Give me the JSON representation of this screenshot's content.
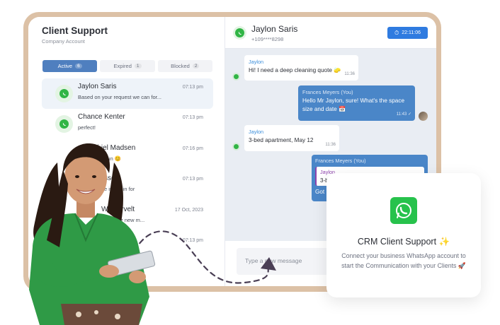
{
  "sidebar": {
    "title": "Client Support",
    "subtitle": "Company Account",
    "tabs": [
      {
        "label": "Active",
        "count": "6"
      },
      {
        "label": "Expired",
        "count": "1"
      },
      {
        "label": "Blocked",
        "count": "2"
      }
    ],
    "chats": [
      {
        "name": "Jaylon Saris",
        "preview": "Based on your request we can for...",
        "time": "07:13 pm"
      },
      {
        "name": "Chance Kenter",
        "preview": "perfect!",
        "time": "07:13 pm"
      },
      {
        "name": "m Rhiel Madsen",
        "preview": "t's fun 😊",
        "time": "07:16 pm"
      },
      {
        "name": "ssex",
        "preview": "e in 2 min for",
        "time": "07:13 pm"
      },
      {
        "name": "Westervelt",
        "preview": "es for new m...",
        "time": "17 Oct, 2023"
      },
      {
        "name": "",
        "preview": "",
        "time": "07:13 pm"
      }
    ]
  },
  "chat": {
    "contact_name": "Jaylon Saris",
    "contact_phone": "+109****8298",
    "timer": "22:11:06",
    "messages": [
      {
        "sender": "Jaylon",
        "text": "Hi! I need a deep cleaning quote 🧽",
        "time": "11:36"
      },
      {
        "sender": "Frances Meyers (You)",
        "text": "Hello Mr Jaylon, sure! What's the space size and date 📅",
        "time": "11:43 ✓"
      },
      {
        "sender": "Jaylon",
        "text": "3-bed apartment, May 12",
        "time": "11:36"
      },
      {
        "sender": "Frances Meyers (You)",
        "quote_sender": "Jaylon",
        "quote_text": "3-be",
        "text": "Got"
      }
    ],
    "input_placeholder": "Type a new message"
  },
  "card": {
    "title": "CRM Client Support ✨",
    "description": "Connect your business WhatsApp account to start the Communication with your Clients 🚀"
  },
  "colors": {
    "accent": "#4f7fbf",
    "whatsapp": "#27c24c",
    "frame": "#dcc1a6"
  }
}
